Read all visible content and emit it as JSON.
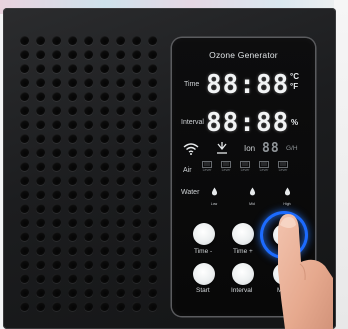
{
  "panel": {
    "title": "Ozone Generator",
    "time_label": "Time",
    "time_display": "88:88",
    "time_unit_c": "°C",
    "time_unit_f": "°F",
    "interval_label": "Interval",
    "interval_display": "88:88",
    "interval_unit": "%",
    "ion_label": "Ion",
    "output_display": "88",
    "output_unit": "G/H",
    "air_label": "Air",
    "air_levels": [
      "Lever",
      "Lever",
      "Lever",
      "Lever",
      "Lever"
    ],
    "water_label": "Water",
    "water_levels": [
      "Low",
      "Mid",
      "High"
    ]
  },
  "buttons": {
    "time_minus": "Time -",
    "time_plus": "Time +",
    "start": "Start",
    "interval": "Interval",
    "mode_partial": "M"
  },
  "colors": {
    "body": "#1c1d1f",
    "panel": "#0a0a0b",
    "display": "#f2f4f5",
    "accent_ring": "#1c6bff",
    "button": "#eceff0"
  },
  "icons": [
    "wifi-icon",
    "sterilize-icon",
    "air-level-icon",
    "water-drop-icon",
    "pointing-finger-icon"
  ]
}
